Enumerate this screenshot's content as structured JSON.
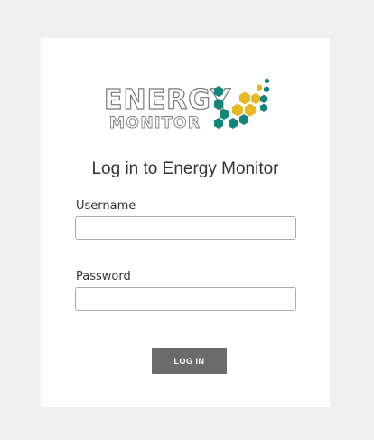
{
  "logo": {
    "line1": "ENERGY",
    "line2": "MONITOR",
    "colors": {
      "teal": "#12867b",
      "yellow": "#e8b820",
      "outline": "#7a7a7a"
    }
  },
  "title": "Log in to Energy Monitor",
  "form": {
    "username_label": "Username",
    "username_value": "",
    "password_label": "Password",
    "password_value": "",
    "submit_label": "LOG IN"
  },
  "colors": {
    "page_background": "#f0f0f0",
    "card_background": "#ffffff",
    "button_background": "#6b6b6b"
  }
}
